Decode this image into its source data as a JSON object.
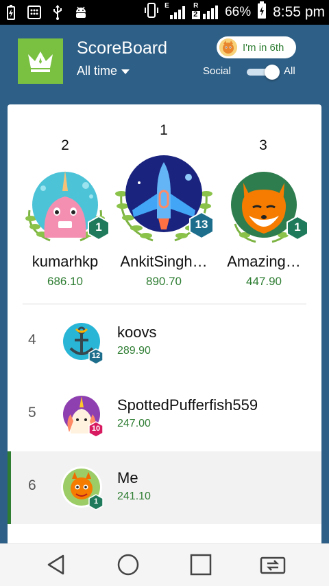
{
  "status_bar": {
    "battery": "66%",
    "time": "8:55 pm",
    "network_e": "E",
    "network_r": "R",
    "sim_slot": "2"
  },
  "header": {
    "title": "ScoreBoard",
    "period": "All time",
    "rank_chip": "I'm in 6th",
    "filter_left": "Social",
    "filter_right": "All",
    "accent_color": "#7ac142"
  },
  "podium": [
    {
      "rank": "2",
      "name": "kumarhkp",
      "score": "686.10",
      "level": "1",
      "avatar": "narwhal"
    },
    {
      "rank": "1",
      "name": "AnkitSingh…",
      "score": "890.70",
      "level": "13",
      "avatar": "spaceship"
    },
    {
      "rank": "3",
      "name": "Amazing…",
      "score": "447.90",
      "level": "1",
      "avatar": "fox"
    }
  ],
  "rows": [
    {
      "rank": "4",
      "name": "koovs",
      "score": "289.90",
      "level": "12",
      "avatar": "anchor"
    },
    {
      "rank": "5",
      "name": "SpottedPufferfish559",
      "score": "247.00",
      "level": "10",
      "avatar": "unicorn"
    },
    {
      "rank": "6",
      "name": "Me",
      "score": "241.10",
      "level": "1",
      "avatar": "dragon"
    }
  ],
  "colors": {
    "header_bg": "#2e5f86",
    "score_green": "#2e7d32",
    "badge_green": "#1e7a5a",
    "badge_teal": "#1c6e8c",
    "badge_pink": "#d81b60"
  },
  "nav": [
    "back-icon",
    "home-icon",
    "recents-icon",
    "switch-sim-icon"
  ]
}
